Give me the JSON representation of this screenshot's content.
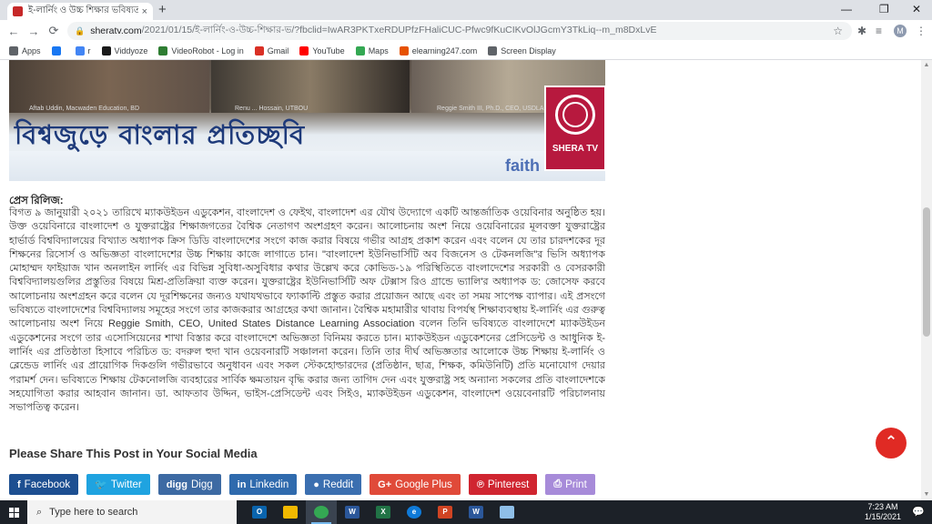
{
  "browser": {
    "tab_title": "ই-লার্নিং ও উচ্চ শিক্ষার ভবিষ্যত - S",
    "tab_close": "×",
    "new_tab": "+",
    "url_host": "sheratv.com",
    "url_path": "/2021/01/15/ই-লার্নিং-ও-উচ্চ-শিক্ষার-ভ/?fbclid=IwAR3PKTxeRDUPfzFHaliCUC-Pfwc9fKuCIKvOlJGcmY3TkLiq--m_m8DxLvE",
    "profile_initial": "M",
    "window_controls": {
      "minimize": "—",
      "restore": "❐",
      "close": "✕"
    },
    "nav": {
      "back": "←",
      "forward": "→",
      "reload": "⟳"
    }
  },
  "bookmarks": [
    {
      "label": "Apps",
      "color": "#5f6368"
    },
    {
      "label": "",
      "color": "#1877f2"
    },
    {
      "label": "r",
      "color": "#4285f4"
    },
    {
      "label": "Viddyoze",
      "color": "#1a1a1a"
    },
    {
      "label": "VideoRobot - Log in",
      "color": "#2e7d32"
    },
    {
      "label": "Gmail",
      "color": "#d93025"
    },
    {
      "label": "YouTube",
      "color": "#ff0000"
    },
    {
      "label": "Maps",
      "color": "#34a853"
    },
    {
      "label": "elearning247.com",
      "color": "#e65100"
    },
    {
      "label": "Screen Display",
      "color": "#5f6368"
    }
  ],
  "hero": {
    "captions": [
      "Aftab Uddin, Macwaden Education, BD",
      "Renu ... Hossain, UTBOU",
      "Reggie Smith III, Ph.D., CEO, USDLA"
    ],
    "title": "বিশ্বজুড়ে বাংলার প্রতিচ্ছবি",
    "watermark": "faith",
    "logo_label": "SHERA TV"
  },
  "article": {
    "press_label": "প্রেস রিলিজ:",
    "body": "বিগত ৯ জানুয়ারী ২০২১ তারিখে ম্যাকউইডন এডুকেশন, বাংলাদেশ ও ফেইথ, বাংলাদেশ এর যৌথ উদ্যোগে একটি আন্তর্জাতিক ওয়েবিনার অনুষ্ঠিত হয়। উক্ত ওয়েবিনারে বাংলাদেশ ও যুক্তরাষ্ট্রের শিক্ষাজগতের বৈশ্বিক নেতাগণ অংশগ্রহণ করেন। আলোচনায় অংশ নিয়ে ওয়েবিনারের মূলবক্তা যুক্তরাষ্ট্রের হার্ভার্ড বিশ্ববিদ্যালয়ের বিখ্যাত অধ্যাপক ক্রিস ডিডি বাংলাদেশের সংগে কাজ করার বিষয়ে গভীর আগ্রহ প্রকাশ করেন এবং বলেন যে তার চারদশকের দূর শিক্ষনের রিসোর্স ও অভিজ্ঞতা বাংলাদেশের উচ্চ শিক্ষায় কাজে লাগাতে চান। \"বাংলাদেশ ইউনিভার্সিটি অব বিজনেস ও টেকনলজি\"র ভিসি অধ্যাপক মোহাম্মদ ফাইয়াজ খান অনলাইন লার্নিং এর বিভিন্ন সুবিধা-অসুবিধার কথার উল্লেখ করে কোভিড-১৯ পরিস্থিতিতে বাংলাদেশের সরকারী ও বেসরকারী বিশ্ববিদ্যালয়গুলির প্রস্তুতির বিষয়ে মিশ্র-প্রতিক্রিয়া ব্যক্ত করেন। যুক্তরাষ্ট্রের ইউনিভার্সিটি অফ টেক্সাস রিও গ্রান্ডে ভ্যালি'র অধ্যাপক ড: জোসেফ করবে আলোচনায় অংশগ্রহন করে বলেন যে দূরশিক্ষনের জন্যও যথাযথভাবে ফ্যাকাল্টি প্রস্তুত করার প্রয়োজন আছে এবং তা সময় সাপেক্ষ ব্যাপার। এই প্রসংগে ভবিষ্যতে বাংলাদেশের বিশ্ববিদ্যালয় সমূহের সংগে তার কাজকরার আগ্রহের কথা জানান। বৈশ্বিক মহামারীর থাবায় বিপর্যস্থ শিক্ষাব্যবস্থায় ই-লার্নিং এর গুরুত্ব আলোচনায় অংশ নিয়ে Reggie Smith, CEO, United States Distance Learning Association বলেন তিনি ভবিষ্যতে বাংলাদেশে ম্যাকউইডন এডুকেশনের সংগে তার এসোসিয়েনের শাখা বিস্তার করে বাংলাদেশে অভিজ্ঞতা বিনিময় করতে চান। ম্যাকউইডন এডুকেশনের প্রেসিডেন্ট ও আধুনিক ই-লার্নিং এর প্রতিষ্ঠাতা হিসাবে পরিচিত ড: বদরুল হুদা খান ওয়েবনারটি সঞ্চালনা করেন। তিনি তার দীর্ঘ অভিজ্ঞতার আলোকে উচ্চ শিক্ষায় ই-লার্নিং ও ব্লেন্ডেড লার্নিং এর প্রায়োগিক দিকগুলি গভীরভাবে অনুধাবন এবং সকল স্টেকহোল্ডারদের (প্রতিষ্ঠান, ছাত্র, শিক্ষক, কমিউনিটি) প্রতি মনোযোগ দেয়ার পরামর্শ দেন। ভবিষ্যতে শিক্ষায় টেকনোলজি ব্যবহারের সার্বিক ক্ষমতায়ন বৃদ্ধি করার জন্য তাগিদ দেন এবং যুক্তরাষ্ট্র সহ অন্যান্য সকলের প্রতি বাংলাদেশকে সহযোগিতা করার আহবান জানান। ডা. আফতাব উদ্দিন, ভাইস-প্রেসিডেন্ট এবং সিইও, ম্যাকউইডন এডুকেশন, বাংলাদেশ ওয়েবেনারটি পরিচালনায় সভাপতিত্ব করেন।"
  },
  "share": {
    "heading": "Please Share This Post in Your Social Media",
    "buttons": [
      {
        "icon": "f",
        "label": "Facebook",
        "color": "#1d4f91"
      },
      {
        "icon": "🐦",
        "label": "Twitter",
        "color": "#1fa3e0"
      },
      {
        "icon": "digg",
        "label": "Digg",
        "color": "#3d6aa3"
      },
      {
        "icon": "in",
        "label": "Linkedin",
        "color": "#2f6aad"
      },
      {
        "icon": "●",
        "label": "Reddit",
        "color": "#3b6fb0"
      },
      {
        "icon": "G+",
        "label": "Google Plus",
        "color": "#e04a39"
      },
      {
        "icon": "℗",
        "label": "Pinterest",
        "color": "#d02530"
      },
      {
        "icon": "⎙",
        "label": "Print",
        "color": "#a78bd9"
      }
    ]
  },
  "scroll_to_top": "⌃",
  "taskbar": {
    "search_placeholder": "Type here to search",
    "apps": [
      {
        "icon": "outlook-icon",
        "text": "O",
        "color": "#0a64ad"
      },
      {
        "icon": "file-explorer-icon",
        "text": "",
        "color": "#f2b900"
      },
      {
        "icon": "chrome-icon",
        "text": "",
        "color": "#34a853"
      },
      {
        "icon": "word-icon",
        "text": "W",
        "color": "#2b579a"
      },
      {
        "icon": "excel-icon",
        "text": "X",
        "color": "#217346"
      },
      {
        "icon": "edge-icon",
        "text": "e",
        "color": "#0f7ad8"
      },
      {
        "icon": "powerpoint-icon",
        "text": "P",
        "color": "#d04423"
      },
      {
        "icon": "word-alt-icon",
        "text": "W",
        "color": "#2b579a"
      },
      {
        "icon": "paint-icon",
        "text": "",
        "color": "#8fbfe8"
      }
    ],
    "time": "7:23 AM",
    "date": "1/15/2021",
    "notification": "💬"
  }
}
